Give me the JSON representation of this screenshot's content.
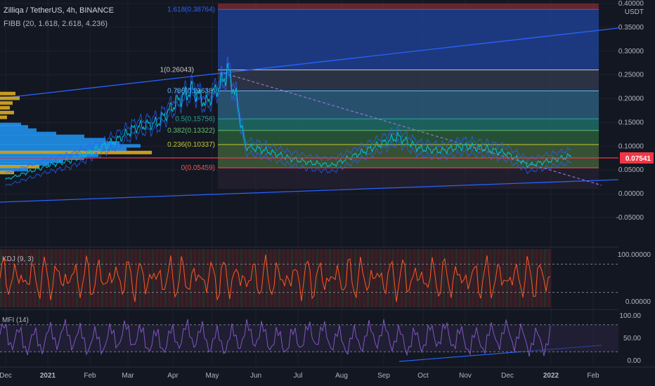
{
  "header": {
    "symbol_line": "Zilliqa / TetherUS, 4h, BINANCE",
    "indicator_line": "FIBB (20, 1.618, 2.618, 4.236)"
  },
  "price_axis": {
    "currency": "USDT",
    "ticks": [
      "0.40000",
      "0.35000",
      "0.30000",
      "0.25000",
      "0.20000",
      "0.15000",
      "0.10000",
      "0.05000",
      "0.00000",
      "-0.05000"
    ],
    "last_price": "0.07541",
    "last_price_color": "#f23645"
  },
  "fib_labels": [
    "1.618(0.38764)",
    "1(0.26043)",
    "0.786(0.21638)",
    "0.5(0.15756)",
    "0.382(0.13322)",
    "0.236(0.10337)",
    "0(0.05459)"
  ],
  "kdj": {
    "label": "KDJ (9, 3)",
    "ticks": [
      "100.00000",
      "0.00000"
    ]
  },
  "mfi": {
    "label": "MFI (14)",
    "ticks": [
      "100.00",
      "50.00",
      "0.00"
    ]
  },
  "time_axis": [
    "Dec",
    "2021",
    "Feb",
    "Mar",
    "Apr",
    "May",
    "Jun",
    "Jul",
    "Aug",
    "Sep",
    "Oct",
    "Nov",
    "Dec",
    "2022",
    "Feb"
  ],
  "colors": {
    "background": "#131722",
    "price_line": "#00bcd4",
    "band": "#2962ff",
    "kdj": "#ff5722",
    "mfi": "#7e57c2",
    "volume_profile_up": "#2196f3",
    "volume_profile_down": "#e6b422"
  },
  "chart_data": {
    "type": "line",
    "title": "Zilliqa / TetherUS, 4h, BINANCE",
    "ylabel": "USDT",
    "ylim": [
      -0.05,
      0.4
    ],
    "x_labels": [
      "Dec",
      "2021",
      "Feb",
      "Mar",
      "Apr",
      "May",
      "Jun",
      "Jul",
      "Aug",
      "Sep",
      "Oct",
      "Nov",
      "Dec",
      "2022",
      "Feb"
    ],
    "series": [
      {
        "name": "Zilliqa / TetherUS",
        "x_months": [
          0,
          0.5,
          1,
          1.5,
          2,
          2.5,
          3,
          3.5,
          4,
          4.3,
          4.6,
          5,
          5.1,
          5.3,
          5.5,
          6,
          6.5,
          7,
          7.5,
          8,
          8.5,
          9,
          9.5,
          10,
          10.5,
          11,
          11.5,
          12,
          12.5,
          13
        ],
        "values": [
          0.03,
          0.045,
          0.06,
          0.07,
          0.09,
          0.11,
          0.14,
          0.15,
          0.2,
          0.22,
          0.19,
          0.24,
          0.26,
          0.2,
          0.1,
          0.09,
          0.075,
          0.065,
          0.06,
          0.08,
          0.1,
          0.12,
          0.095,
          0.09,
          0.1,
          0.095,
          0.085,
          0.06,
          0.07,
          0.08
        ]
      }
    ],
    "fibonacci": [
      {
        "level": 1.618,
        "price": 0.38764
      },
      {
        "level": 1,
        "price": 0.26043
      },
      {
        "level": 0.786,
        "price": 0.21638
      },
      {
        "level": 0.5,
        "price": 0.15756
      },
      {
        "level": 0.382,
        "price": 0.13322
      },
      {
        "level": 0.236,
        "price": 0.10337
      },
      {
        "level": 0,
        "price": 0.05459
      }
    ],
    "last_price": 0.07541,
    "kdj_range": [
      0,
      100
    ],
    "mfi_range": [
      0,
      100
    ],
    "grid": true
  }
}
